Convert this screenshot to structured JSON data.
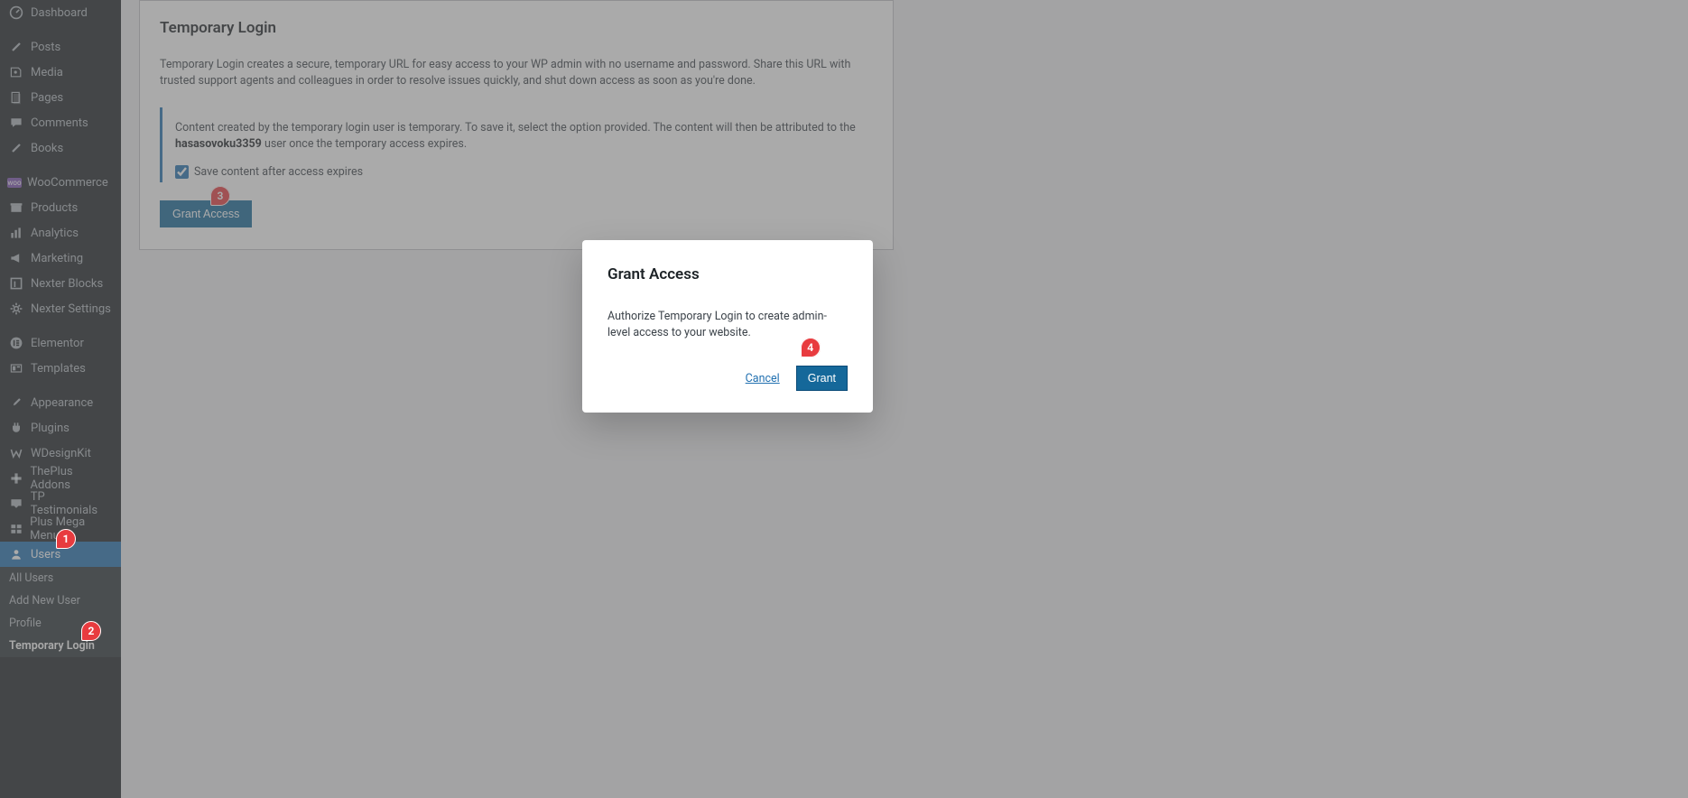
{
  "sidebar": {
    "items": [
      {
        "label": "Dashboard",
        "icon": "dashboard"
      },
      {
        "label": "Posts",
        "icon": "pin"
      },
      {
        "label": "Media",
        "icon": "media"
      },
      {
        "label": "Pages",
        "icon": "pages"
      },
      {
        "label": "Comments",
        "icon": "comment"
      },
      {
        "label": "Books",
        "icon": "pin"
      },
      {
        "label": "WooCommerce",
        "icon": "woo"
      },
      {
        "label": "Products",
        "icon": "archive"
      },
      {
        "label": "Analytics",
        "icon": "analytics"
      },
      {
        "label": "Marketing",
        "icon": "megaphone"
      },
      {
        "label": "Nexter Blocks",
        "icon": "blocks"
      },
      {
        "label": "Nexter Settings",
        "icon": "gear"
      },
      {
        "label": "Elementor",
        "icon": "elementor"
      },
      {
        "label": "Templates",
        "icon": "templates"
      },
      {
        "label": "Appearance",
        "icon": "brush"
      },
      {
        "label": "Plugins",
        "icon": "plug"
      },
      {
        "label": "WDesignKit",
        "icon": "wdk"
      },
      {
        "label": "ThePlus Addons",
        "icon": "theplus"
      },
      {
        "label": "TP Testimonials",
        "icon": "testimonial"
      },
      {
        "label": "Plus Mega Menu",
        "icon": "megamenu"
      },
      {
        "label": "Users",
        "icon": "user"
      }
    ],
    "submenu": [
      {
        "label": "All Users"
      },
      {
        "label": "Add New User"
      },
      {
        "label": "Profile"
      },
      {
        "label": "Temporary Login"
      }
    ]
  },
  "panel": {
    "title": "Temporary Login",
    "description": "Temporary Login creates a secure, temporary URL for easy access to your WP admin with no username and password. Share this URL with trusted support agents and colleagues in order to resolve issues quickly, and shut down access as soon as you're done.",
    "notice_pre": "Content created by the temporary login user is temporary. To save it, select the option provided. The content will then be attributed to the ",
    "notice_user": "hasasovoku3359",
    "notice_post": " user once the temporary access expires.",
    "checkbox_label": "Save content after access expires",
    "button": "Grant Access"
  },
  "modal": {
    "title": "Grant Access",
    "body": "Authorize Temporary Login to create admin-level access to your website.",
    "cancel": "Cancel",
    "grant": "Grant"
  },
  "badges": {
    "b1": "1",
    "b2": "2",
    "b3": "3",
    "b4": "4"
  }
}
